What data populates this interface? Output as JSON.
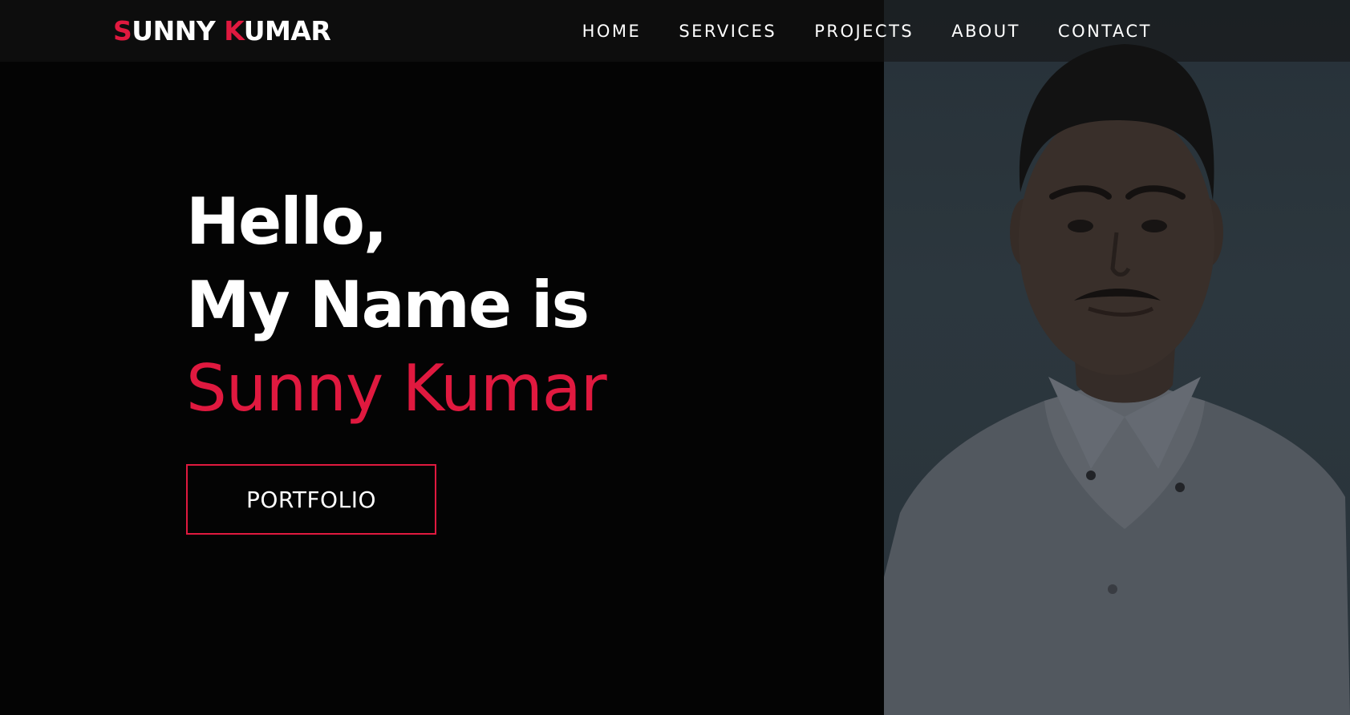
{
  "navbar": {
    "logo": {
      "first_initial": "S",
      "first_rest": "UNNY ",
      "last_initial": "K",
      "last_rest": "UMAR"
    },
    "links": [
      {
        "label": "HOME"
      },
      {
        "label": "SERVICES"
      },
      {
        "label": "PROJECTS"
      },
      {
        "label": "ABOUT"
      },
      {
        "label": "CONTACT"
      }
    ]
  },
  "hero": {
    "line1": "Hello,",
    "line2": "My Name is",
    "name": "Sunny Kumar",
    "button_label": "PORTFOLIO"
  },
  "colors": {
    "accent": "#e0193f",
    "background": "#040404",
    "text": "#ffffff"
  }
}
